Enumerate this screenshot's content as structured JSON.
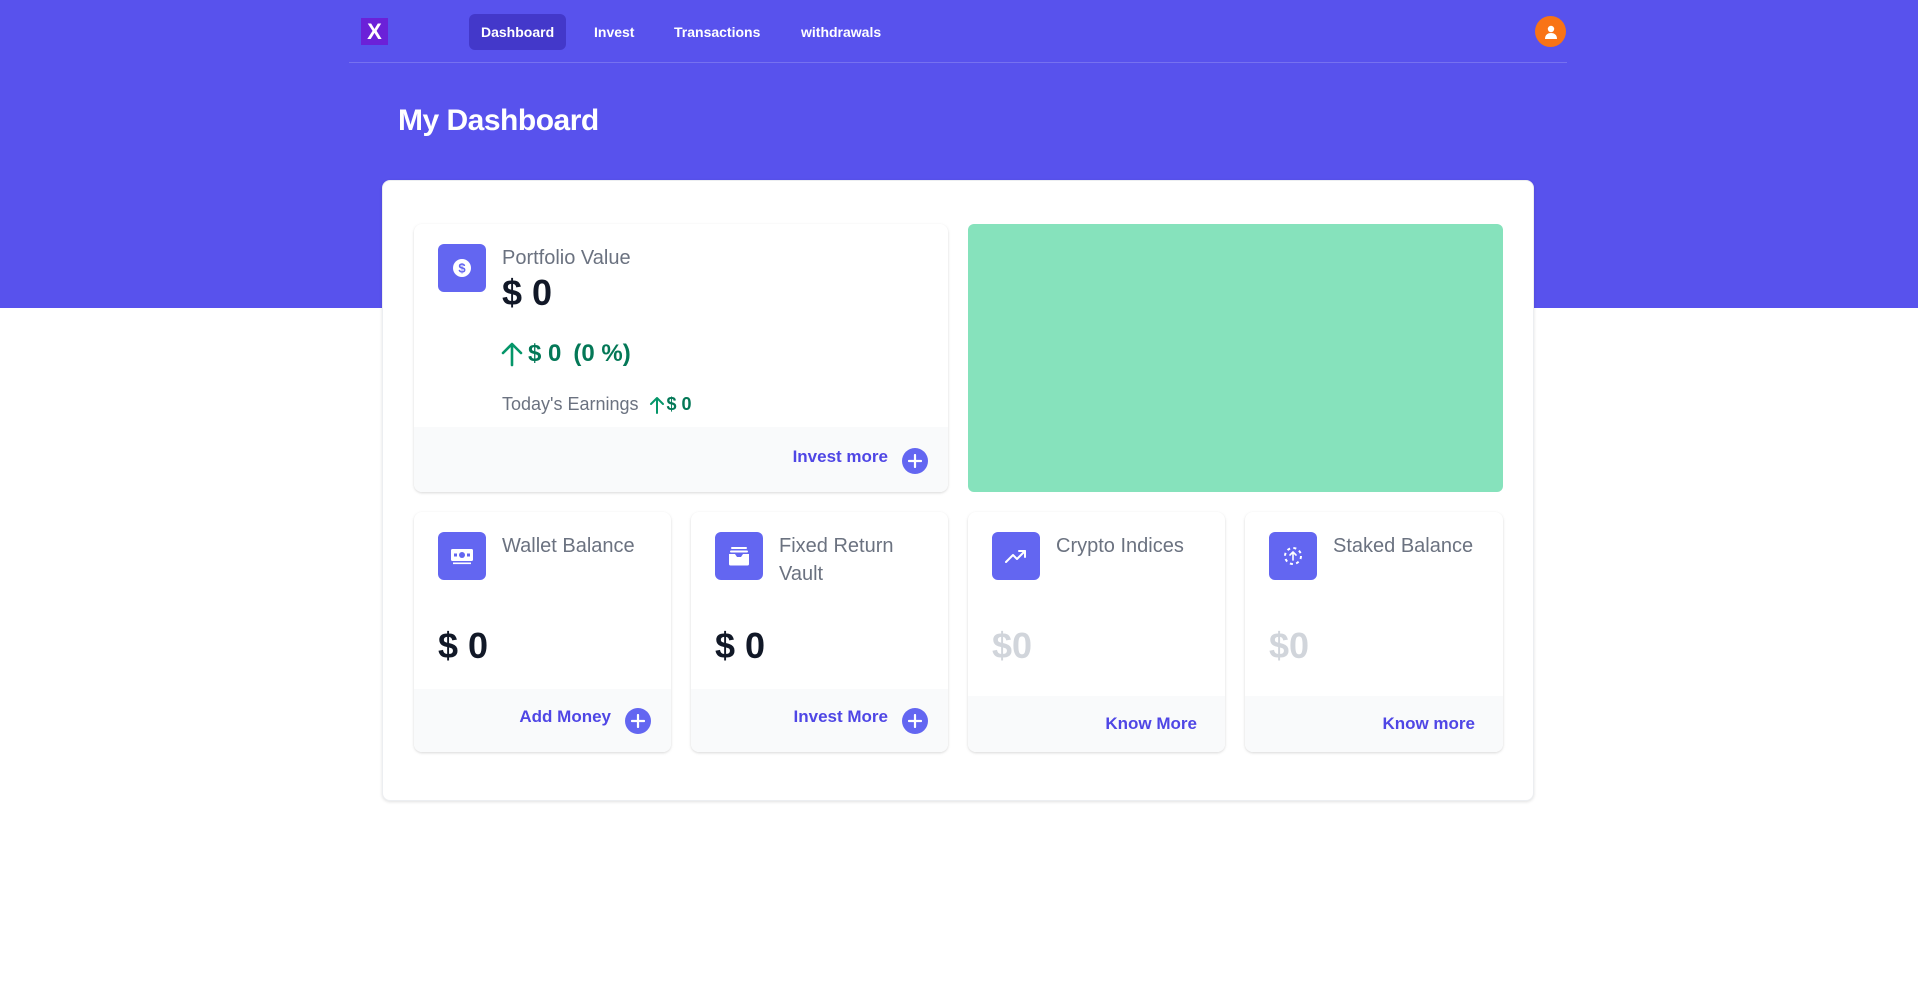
{
  "brand": {
    "logo_text": "X"
  },
  "nav": {
    "items": [
      {
        "label": "Dashboard",
        "active": true
      },
      {
        "label": "Invest",
        "active": false
      },
      {
        "label": "Transactions",
        "active": false
      },
      {
        "label": "withdrawals",
        "active": false
      }
    ],
    "avatar_icon": "user-icon"
  },
  "page": {
    "title": "My Dashboard"
  },
  "portfolio": {
    "icon": "dollar-coin-icon",
    "label": "Portfolio Value",
    "value": "$ 0",
    "change_value": "$ 0",
    "change_percent": "(0 %)",
    "earnings_label": "Today's Earnings",
    "earnings_value": "$ 0",
    "action_label": "Invest more"
  },
  "promo": {
    "color": "#86e2bc"
  },
  "cards": [
    {
      "icon": "cash-icon",
      "label": "Wallet Balance",
      "value": "$ 0",
      "action_label": "Add Money",
      "muted": false
    },
    {
      "icon": "vault-icon",
      "label": "Fixed Return Vault",
      "value": "$ 0",
      "action_label": "Invest More",
      "muted": false
    },
    {
      "icon": "trending-up-icon",
      "label": "Crypto Indices",
      "value": "$0",
      "action_label": "Know More",
      "muted": true
    },
    {
      "icon": "stake-icon",
      "label": "Staked Balance",
      "value": "$0",
      "action_label": "Know more",
      "muted": true
    }
  ],
  "colors": {
    "header": "#5852ed",
    "accent": "#6366f1",
    "link": "#4f46e5",
    "positive": "#047857",
    "promo": "#86e2bc",
    "avatar": "#f97316"
  }
}
